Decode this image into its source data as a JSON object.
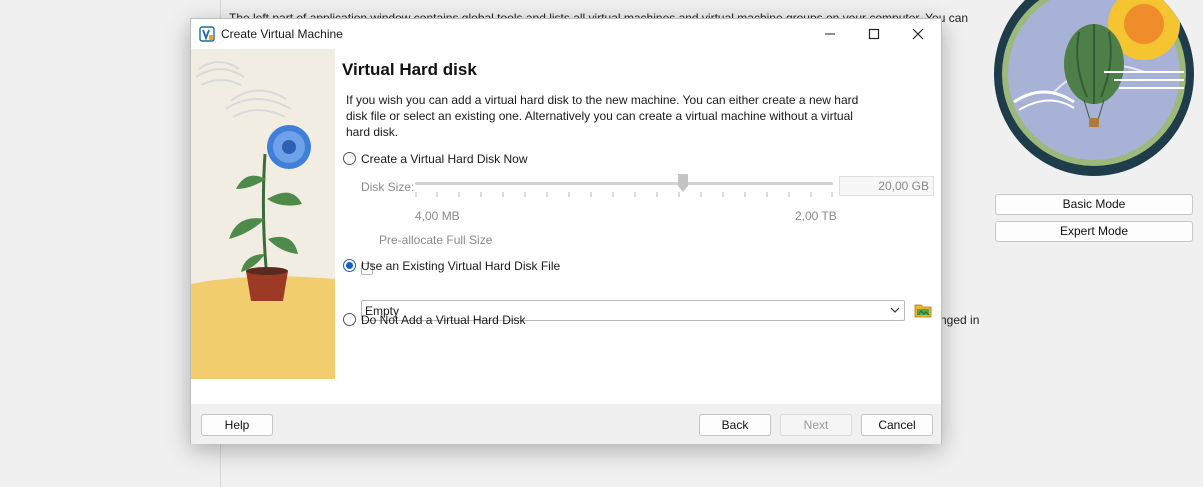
{
  "background": {
    "doc_text_top": "The left part of application window contains global tools and lists all virtual machines and virtual machine groups on your computer. You can",
    "doc_text_right": "nged in",
    "basic_mode_label": "Basic Mode",
    "expert_mode_label": "Expert Mode"
  },
  "dialog": {
    "title": "Create Virtual Machine",
    "heading": "Virtual Hard disk",
    "description": "If you wish you can add a virtual hard disk to the new machine. You can either create a new hard disk file or select an existing one. Alternatively you can create a virtual machine without a virtual hard disk.",
    "options": {
      "create_new": "Create a Virtual Hard Disk Now",
      "use_existing": "Use an Existing Virtual Hard Disk File",
      "no_disk": "Do Not Add a Virtual Hard Disk"
    },
    "selected_option": "use_existing",
    "disk_size": {
      "label": "Disk Size:",
      "value": "20,00 GB",
      "min_label": "4,00 MB",
      "max_label": "2,00 TB",
      "slider_position_fraction": 0.64
    },
    "preallocate_label": "Pre-allocate Full Size",
    "existing_file_value": "Empty",
    "buttons": {
      "help": "Help",
      "back": "Back",
      "next": "Next",
      "cancel": "Cancel"
    }
  },
  "colors": {
    "accent": "#1560bd",
    "footer_bg": "#f0f0f0",
    "side_yellow": "#f2cd6e"
  },
  "icons": [
    "virtualbox-app-icon",
    "minimize-icon",
    "maximize-icon",
    "close-icon",
    "chevron-down-icon",
    "folder-open-icon",
    "flower-pot-illustration",
    "hot-air-balloon-illustration"
  ]
}
